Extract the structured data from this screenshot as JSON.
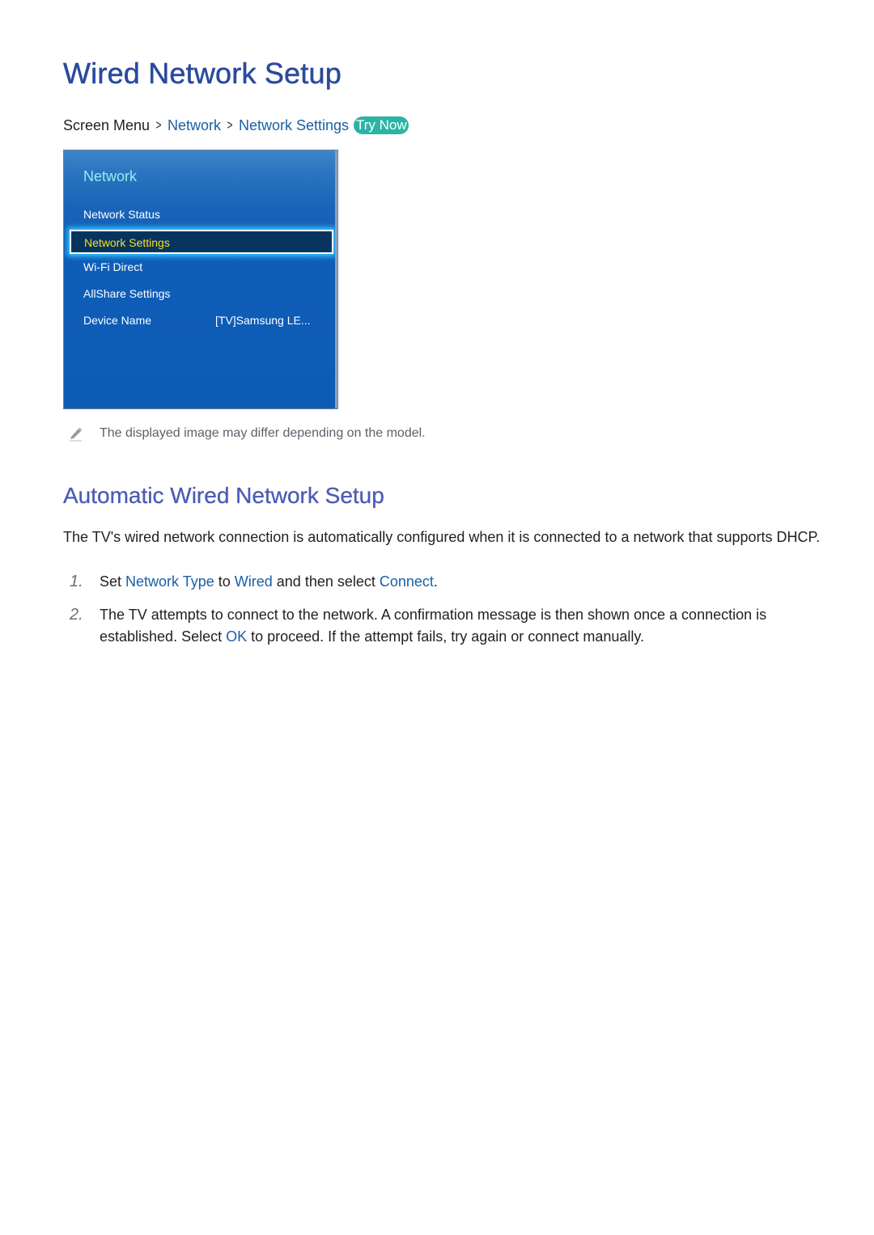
{
  "page": {
    "title": "Wired Network Setup"
  },
  "breadcrumb": {
    "root": "Screen Menu",
    "items": [
      "Network",
      "Network Settings"
    ],
    "separator_icon": "chevron-right-icon",
    "try_now_label": "Try Now"
  },
  "tv_menu": {
    "title": "Network",
    "items": [
      {
        "label": "Network Status",
        "value": ""
      },
      {
        "label": "Network Settings",
        "value": "",
        "selected": true
      },
      {
        "label": "Wi-Fi Direct",
        "value": ""
      },
      {
        "label": "AllShare Settings",
        "value": ""
      },
      {
        "label": "Device Name",
        "value": "[TV]Samsung LE..."
      }
    ],
    "colors": {
      "title": "#8ff0ee",
      "selected_text": "#f4e01c",
      "selected_bg": "#07335f",
      "panel_bg": "#0c5cb6"
    }
  },
  "note": {
    "icon": "pencil-icon",
    "text": "The displayed image may differ depending on the model."
  },
  "section": {
    "title": "Automatic Wired Network Setup",
    "intro": "The TV's wired network connection is automatically configured when it is connected to a network that supports DHCP.",
    "steps": [
      {
        "number": "1.",
        "parts": [
          {
            "text": "Set ",
            "highlight": false
          },
          {
            "text": "Network Type",
            "highlight": true
          },
          {
            "text": " to ",
            "highlight": false
          },
          {
            "text": "Wired",
            "highlight": true
          },
          {
            "text": " and then select ",
            "highlight": false
          },
          {
            "text": "Connect",
            "highlight": true
          },
          {
            "text": ".",
            "highlight": false
          }
        ]
      },
      {
        "number": "2.",
        "parts": [
          {
            "text": "The TV attempts to connect to the network. A confirmation message is then shown once a connection is established. Select ",
            "highlight": false
          },
          {
            "text": "OK",
            "highlight": true
          },
          {
            "text": " to proceed. If the attempt fails, try again or connect manually.",
            "highlight": false
          }
        ]
      }
    ]
  },
  "colors": {
    "title": "#2a4a9c",
    "section_title": "#4b5bb5",
    "link": "#1a5fa6",
    "try_now_bg": "#2bb4a6",
    "body_text": "#231f20",
    "note_text": "#5f5f6b"
  }
}
